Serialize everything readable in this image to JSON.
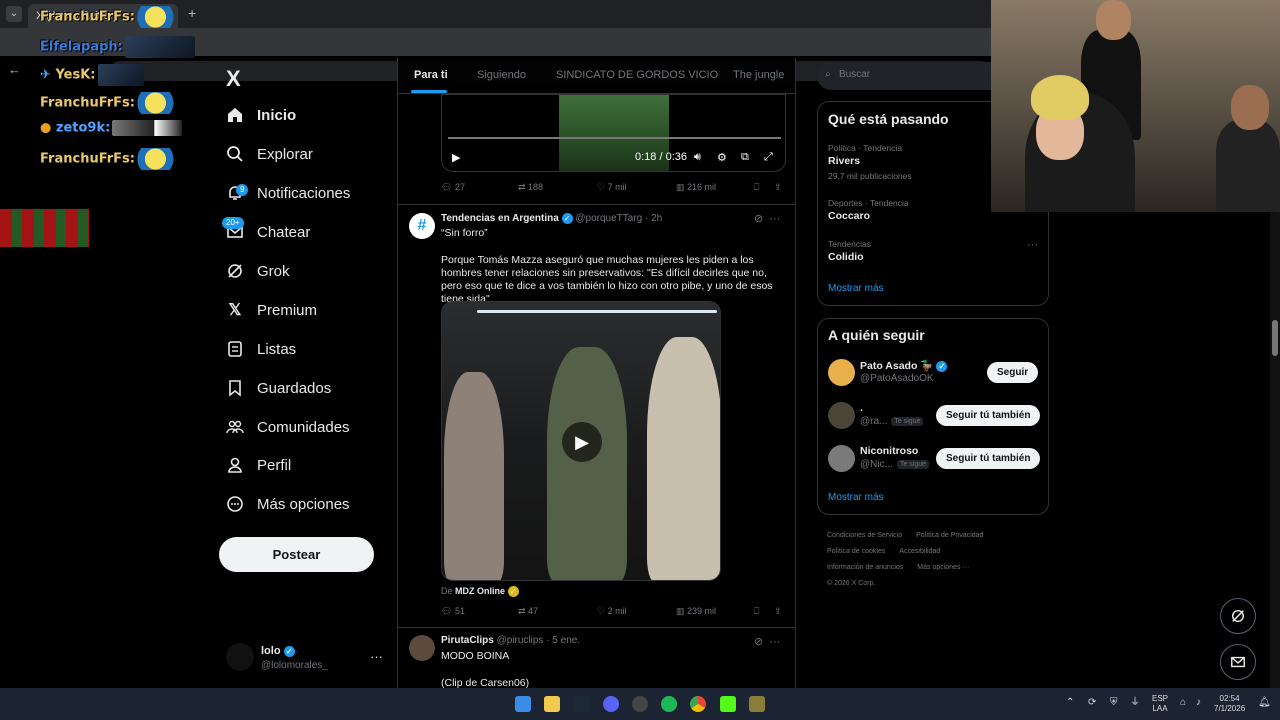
{
  "browser": {
    "tab_title": "X (Antes Twitter)",
    "new_tab_label": "+"
  },
  "chat": {
    "lines": [
      {
        "user": "FranchuFrFs:",
        "color": "#e8c86b"
      },
      {
        "user": "Elfelapaph:",
        "color": "#3a7bd5"
      },
      {
        "user": "YesK:",
        "color": "#e8c86b"
      },
      {
        "user": "FranchuFrFs:",
        "color": "#e8c86b"
      },
      {
        "user": "zeto9k:",
        "color": "#4da3ff"
      },
      {
        "user": "FranchuFrFs:",
        "color": "#e8c86b"
      }
    ]
  },
  "nav": {
    "logo": "X",
    "items": [
      {
        "label": "Inicio",
        "icon": "home-icon"
      },
      {
        "label": "Explorar",
        "icon": "search-icon"
      },
      {
        "label": "Notificaciones",
        "icon": "bell-icon",
        "badge": "9"
      },
      {
        "label": "Chatear",
        "icon": "mail-icon",
        "badge": "20+"
      },
      {
        "label": "Grok",
        "icon": "grok-icon"
      },
      {
        "label": "Premium",
        "icon": "x-icon"
      },
      {
        "label": "Listas",
        "icon": "list-icon"
      },
      {
        "label": "Guardados",
        "icon": "bookmark-icon"
      },
      {
        "label": "Comunidades",
        "icon": "people-icon"
      },
      {
        "label": "Perfil",
        "icon": "person-icon"
      },
      {
        "label": "Más opciones",
        "icon": "more-circle-icon"
      }
    ],
    "post_label": "Postear",
    "account": {
      "name": "lolo",
      "handle": "@lolomorales_",
      "more": "···"
    }
  },
  "timeline": {
    "tabs": [
      "Para ti",
      "Siguiendo",
      "SINDICATO DE GORDOS VICIO",
      "The jungle"
    ],
    "video1": {
      "time": "0:18 / 0:36"
    },
    "post1_actions": {
      "replies": "27",
      "reposts": "188",
      "likes": "7 mil",
      "views": "216 mil"
    },
    "post2": {
      "name": "Tendencias en Argentina",
      "handle": "@porqueTTarg",
      "time": "· 2h",
      "text1": "“Sin forro”",
      "text2": "Porque Tomás Mazza aseguró que muchas mujeres les piden a los hombres tener relaciones sin preservativos: \"Es difícil decirles que no, pero eso que te dice a vos también lo hizo con otro pibe, y uno de esos tiene sida\".",
      "from_prefix": "De",
      "from_name": "MDZ Online",
      "actions": {
        "replies": "51",
        "reposts": "47",
        "likes": "2 mil",
        "views": "239 mil"
      }
    },
    "post3": {
      "name": "PirutaClips",
      "handle": "@piruclips",
      "time": "· 5 ene.",
      "text1": "MODO BOINA",
      "text2": "(Clip de Carsen06)"
    }
  },
  "right": {
    "search_placeholder": "Buscar",
    "trends_title": "Qué está pasando",
    "trends": [
      {
        "category": "Política · Tendencia",
        "name": "Rivers",
        "count": "29,7 mil publicaciones"
      },
      {
        "category": "Deportes · Tendencia",
        "name": "Coccaro",
        "count": ""
      },
      {
        "category": "Tendencias",
        "name": "Colidio",
        "count": ""
      }
    ],
    "trends_more": "Mostrar más",
    "follow_title": "A quién seguir",
    "follows": [
      {
        "name": "Pato Asado 🦆",
        "handle": "@PatoAsadoOK",
        "button": "Seguir",
        "follows_you": ""
      },
      {
        "name": ".",
        "handle": "@ra...",
        "button": "Seguir tú también",
        "follows_you": "Te sigue"
      },
      {
        "name": "Niconitroso",
        "handle": "@Nic...",
        "button": "Seguir tú también",
        "follows_you": "Te sigue"
      }
    ],
    "follow_more": "Mostrar más",
    "footer": [
      "Condiciones de Servicio",
      "Política de Privacidad",
      "Política de cookies",
      "Accesibilidad",
      "Información de anuncios",
      "Más opciones ···",
      "© 2026 X Corp."
    ]
  },
  "taskbar": {
    "lang_top": "ESP",
    "lang_bottom": "LAA",
    "time": "02:54",
    "date": "7/1/2026"
  }
}
